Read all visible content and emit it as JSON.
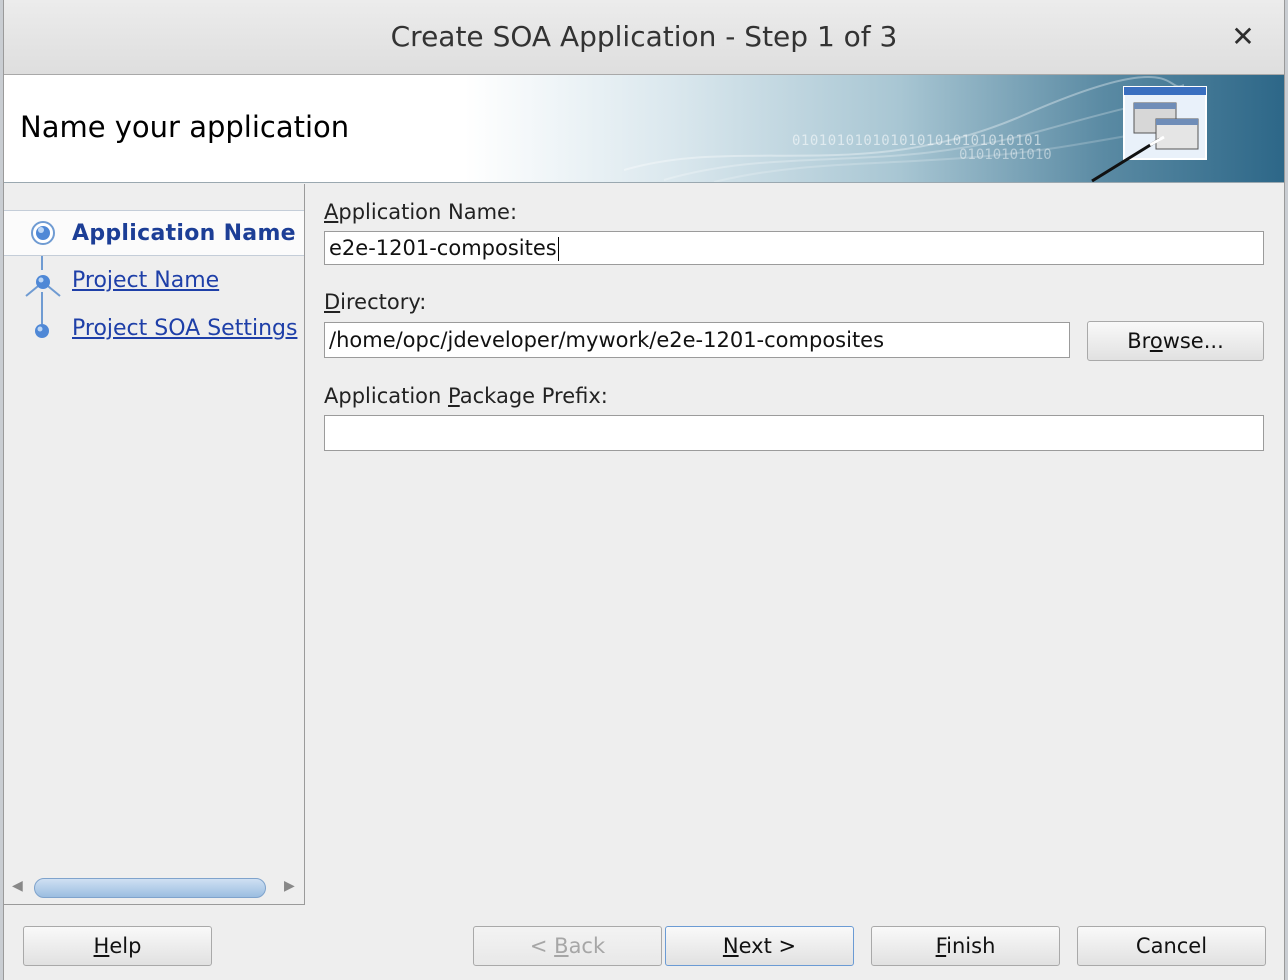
{
  "window": {
    "title": "Create SOA Application - Step 1 of 3",
    "close_glyph": "✕"
  },
  "banner": {
    "title": "Name your application",
    "binary_text_1": "0101010101010101010101010101",
    "binary_text_2": "01010101010",
    "icon": "windows-wizard-icon"
  },
  "steps": [
    {
      "label": "Application Name",
      "state": "current"
    },
    {
      "label": "Project Name",
      "state": "link"
    },
    {
      "label": "Project SOA Settings",
      "state": "link"
    }
  ],
  "form": {
    "app_name": {
      "label_pre": "",
      "label_mn": "A",
      "label_post": "pplication Name:",
      "value": "e2e-1201-composites"
    },
    "directory": {
      "label_pre": "",
      "label_mn": "D",
      "label_post": "irectory:",
      "value": "/home/opc/jdeveloper/mywork/e2e-1201-composites"
    },
    "package_prefix": {
      "label_pre": "Application ",
      "label_mn": "P",
      "label_post": "ackage Prefix:",
      "value": ""
    }
  },
  "buttons": {
    "browse": {
      "pre": "Br",
      "mn": "o",
      "post": "wse..."
    },
    "help": {
      "pre": "",
      "mn": "H",
      "post": "elp"
    },
    "back": {
      "pre": "< ",
      "mn": "B",
      "post": "ack"
    },
    "next": {
      "pre": "",
      "mn": "N",
      "post": "ext >"
    },
    "finish": {
      "pre": "",
      "mn": "F",
      "post": "inish"
    },
    "cancel": {
      "pre": "Cancel",
      "mn": "",
      "post": ""
    }
  },
  "colors": {
    "accent": "#1c3e96",
    "link": "#1e3fa8"
  }
}
